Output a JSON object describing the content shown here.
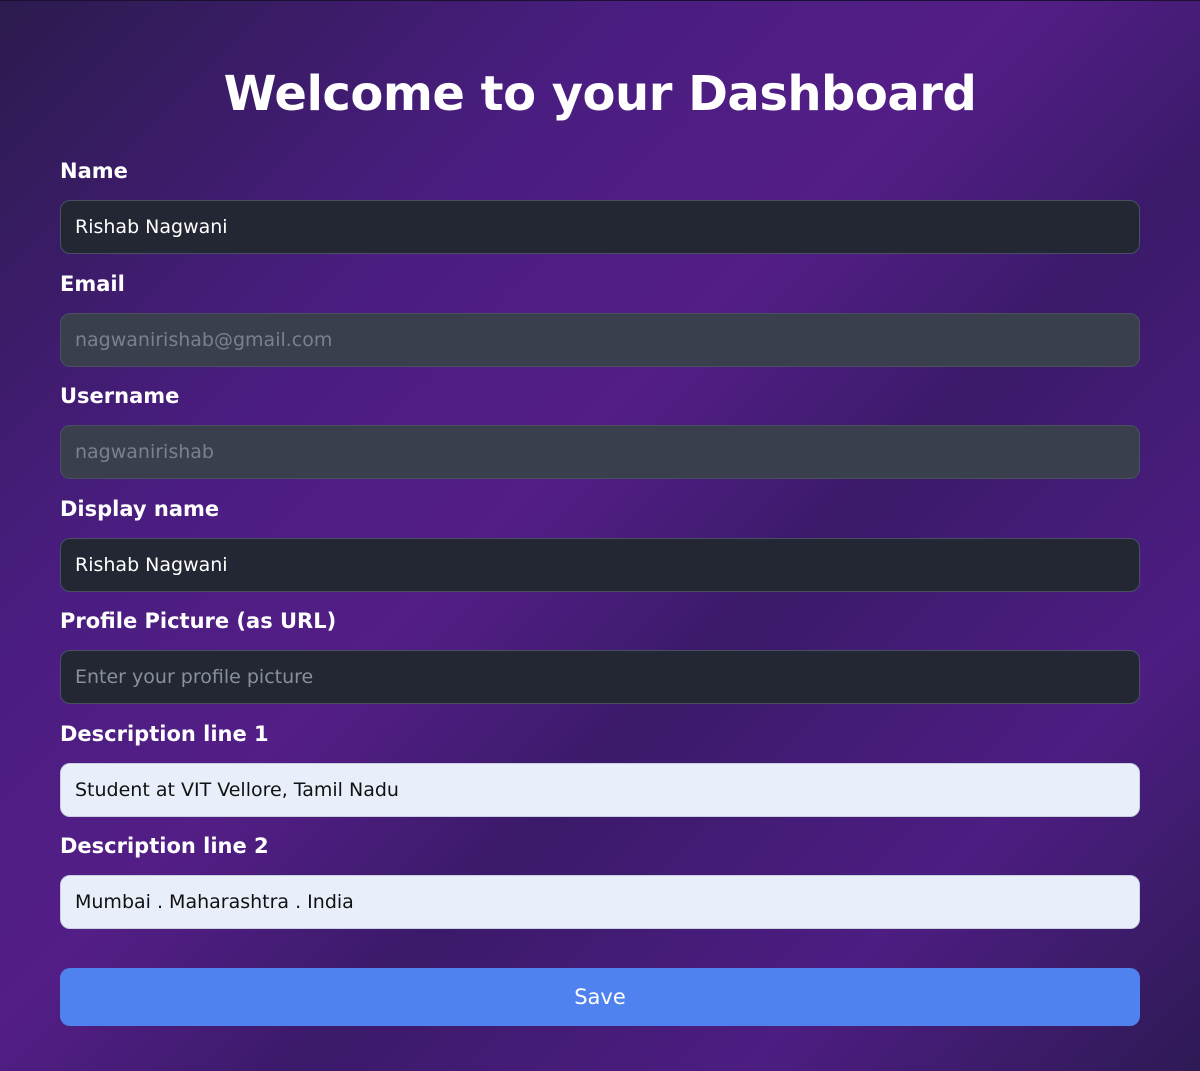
{
  "page": {
    "title": "Welcome to your Dashboard"
  },
  "form": {
    "name": {
      "label": "Name",
      "value": "Rishab Nagwani"
    },
    "email": {
      "label": "Email",
      "value": "nagwanirishab@gmail.com"
    },
    "username": {
      "label": "Username",
      "value": "nagwanirishab"
    },
    "display_name": {
      "label": "Display name",
      "value": "Rishab Nagwani"
    },
    "profile_picture": {
      "label": "Profile Picture (as URL)",
      "value": "",
      "placeholder": "Enter your profile picture"
    },
    "description_1": {
      "label": "Description line 1",
      "value": "Student at VIT Vellore, Tamil Nadu"
    },
    "description_2": {
      "label": "Description line 2",
      "value": "Mumbai . Maharashtra . India"
    },
    "save_label": "Save"
  },
  "colors": {
    "accent": "#4f82ef",
    "input_dark": "#222733",
    "input_disabled": "#3a3f4e",
    "input_light": "#e8effb"
  }
}
